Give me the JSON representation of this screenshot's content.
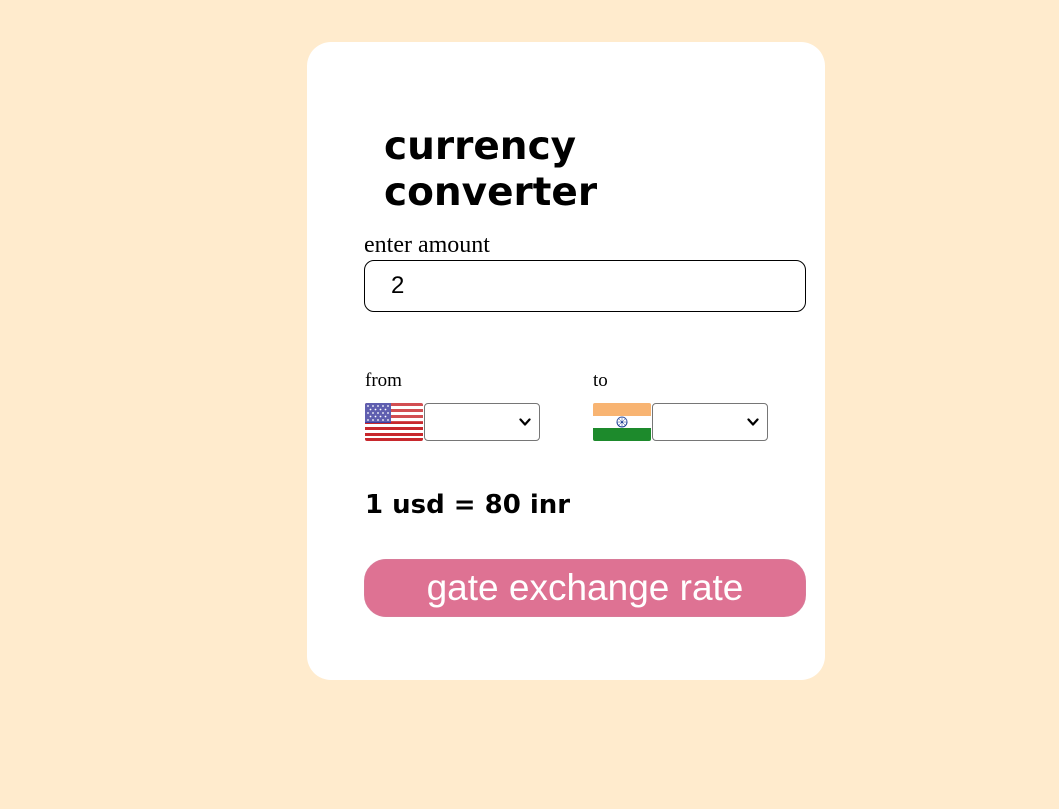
{
  "title": "currency converter",
  "amount": {
    "label": "enter amount",
    "value": "2"
  },
  "from": {
    "label": "from",
    "flag_icon": "us-flag-icon",
    "selected": ""
  },
  "to": {
    "label": "to",
    "flag_icon": "india-flag-icon",
    "selected": ""
  },
  "rate_text": "1 usd = 80 inr",
  "button_label": "gate exchange rate",
  "colors": {
    "page_background": "#ffebcd",
    "card_background": "#ffffff",
    "button_background": "#de7293",
    "button_text": "#ffffff"
  }
}
